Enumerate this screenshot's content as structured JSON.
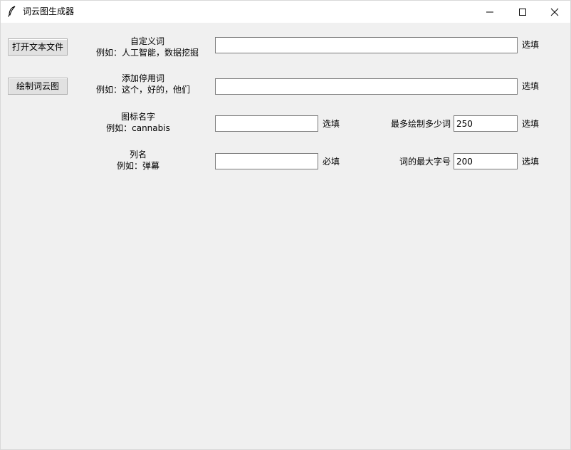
{
  "window": {
    "title": "词云图生成器",
    "icon": "feather-icon"
  },
  "buttons": {
    "open_file": "打开文本文件",
    "draw_cloud": "绘制词云图"
  },
  "fields": {
    "custom_words": {
      "label": "自定义词",
      "example": "例如：人工智能，数据挖掘",
      "value": "",
      "hint": "选填"
    },
    "stop_words": {
      "label": "添加停用词",
      "example": "例如：这个，好的，他们",
      "value": "",
      "hint": "选填"
    },
    "icon_name": {
      "label": "图标名字",
      "example": "例如：cannabis",
      "value": "",
      "hint": "选填"
    },
    "column_name": {
      "label": "列名",
      "example": "例如：弹幕",
      "value": "",
      "hint": "必填"
    },
    "max_words": {
      "label": "最多绘制多少词",
      "value": "250",
      "hint": "选填"
    },
    "max_font_size": {
      "label": "词的最大字号",
      "value": "200",
      "hint": "选填"
    }
  }
}
